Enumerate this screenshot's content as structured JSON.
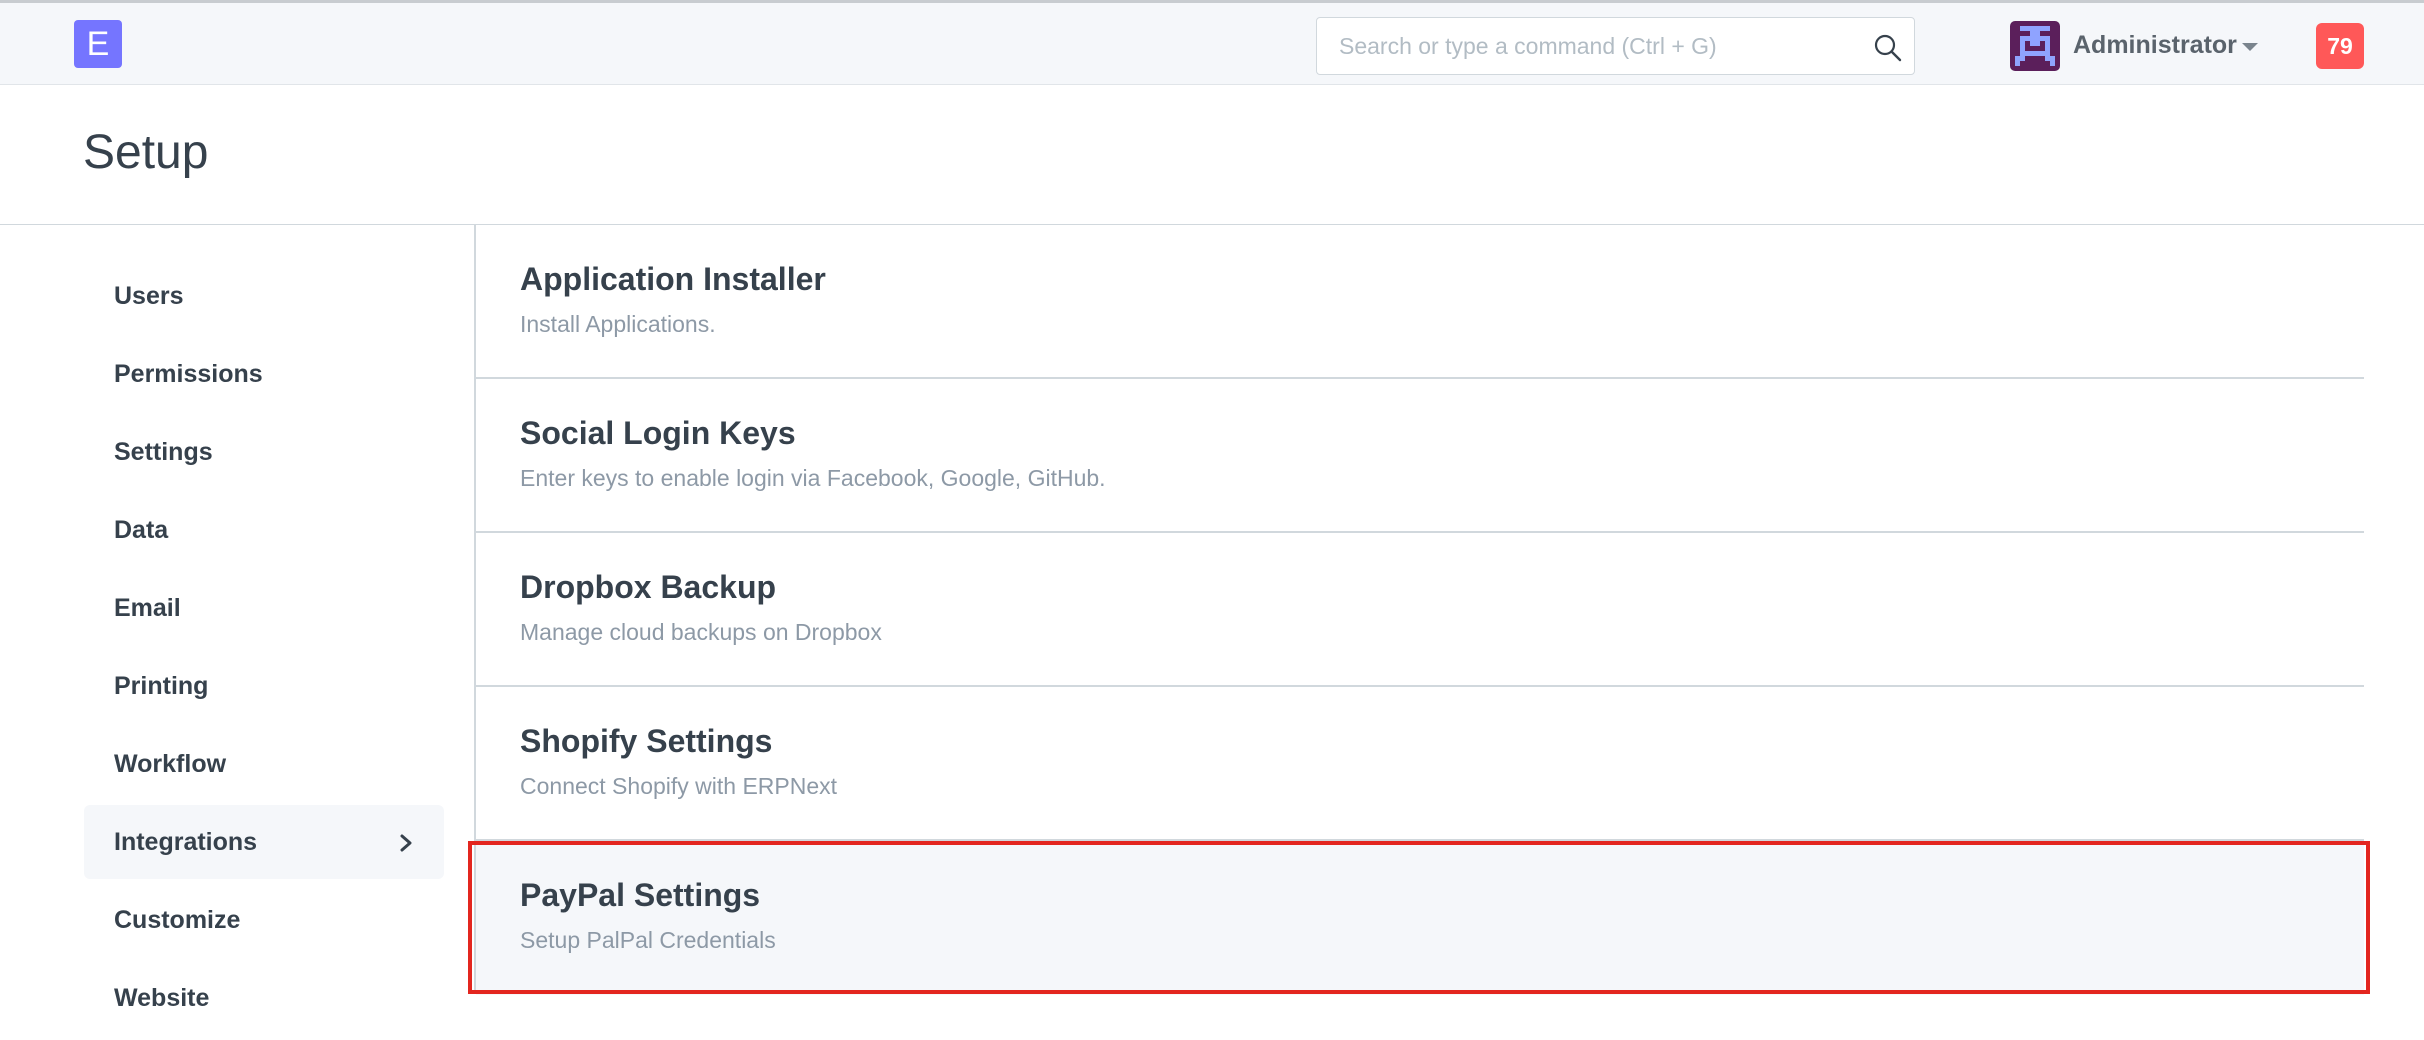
{
  "app": {
    "logo_letter": "E",
    "brand_color": "#7575ff"
  },
  "header": {
    "search_placeholder": "Search or type a command (Ctrl + G)",
    "search_value": "",
    "user_name": "Administrator",
    "notification_count": "79",
    "notification_color": "#ff5858"
  },
  "page": {
    "title": "Setup"
  },
  "sidebar": {
    "items": [
      {
        "label": "Users",
        "active": false
      },
      {
        "label": "Permissions",
        "active": false
      },
      {
        "label": "Settings",
        "active": false
      },
      {
        "label": "Data",
        "active": false
      },
      {
        "label": "Email",
        "active": false
      },
      {
        "label": "Printing",
        "active": false
      },
      {
        "label": "Workflow",
        "active": false
      },
      {
        "label": "Integrations",
        "active": true
      },
      {
        "label": "Customize",
        "active": false
      },
      {
        "label": "Website",
        "active": false
      }
    ]
  },
  "main": {
    "cards": [
      {
        "title": "Application Installer",
        "description": "Install Applications."
      },
      {
        "title": "Social Login Keys",
        "description": "Enter keys to enable login via Facebook, Google, GitHub."
      },
      {
        "title": "Dropbox Backup",
        "description": "Manage cloud backups on Dropbox"
      },
      {
        "title": "Shopify Settings",
        "description": "Connect Shopify with ERPNext"
      },
      {
        "title": "PayPal Settings",
        "description": "Setup PalPal Credentials"
      }
    ],
    "highlight_color": "#e3261f"
  }
}
